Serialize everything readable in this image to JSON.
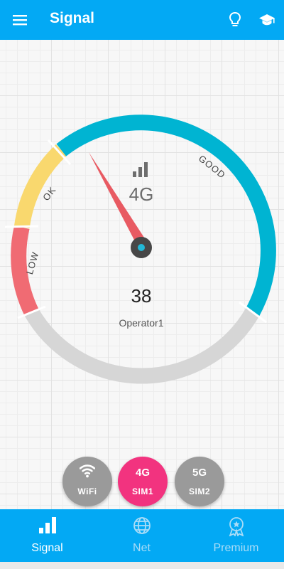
{
  "app_bar": {
    "title": "Signal",
    "background": "#03a9f4",
    "icons": [
      "menu-icon",
      "lightbulb-icon",
      "graduation-cap-icon"
    ]
  },
  "gauge": {
    "zones": [
      {
        "label": "LOW",
        "color": "#f06b73"
      },
      {
        "label": "OK",
        "color": "#f9d86e"
      },
      {
        "label": "GOOD",
        "color": "#00b4d2"
      },
      {
        "label": "",
        "color": "#d6d6d6"
      }
    ],
    "network_type": "4G",
    "value": "38",
    "operator": "Operator1",
    "needle_color": "#e85a62"
  },
  "sim_buttons": [
    {
      "big": "",
      "sub": "WiFi",
      "icon": "wifi-icon",
      "color": "#9a9a9a"
    },
    {
      "big": "4G",
      "sub": "SIM1",
      "color": "#f2337f"
    },
    {
      "big": "5G",
      "sub": "SIM2",
      "color": "#9a9a9a"
    }
  ],
  "bottom_nav": {
    "items": [
      {
        "label": "Signal",
        "icon": "signal-bars-icon",
        "active": true
      },
      {
        "label": "Net",
        "icon": "globe-icon",
        "active": false
      },
      {
        "label": "Premium",
        "icon": "premium-badge-icon",
        "active": false
      }
    ]
  }
}
